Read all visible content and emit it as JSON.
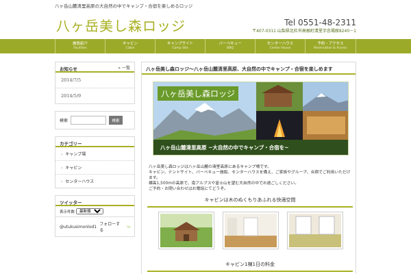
{
  "header": {
    "tagline": "八ヶ岳山麓清里高原の大自然の中でキャンプ・合宿を楽しめるロッジ",
    "logo": "八ヶ岳美し森ロッジ",
    "tel": "Tel 0551-48-2311",
    "address": "〒407-0311 山梨県北杜市高根町清里字念場原8240－1"
  },
  "nav": [
    {
      "jp": "施設紹介",
      "en": "Facilities"
    },
    {
      "jp": "キャビン",
      "en": "Cabin"
    },
    {
      "jp": "キャンプサイト",
      "en": "Camp Site"
    },
    {
      "jp": "バーベキュー",
      "en": "BBQ"
    },
    {
      "jp": "センターハウス",
      "en": "Center House"
    },
    {
      "jp": "予約・アクセス",
      "en": "Reservation & Access"
    }
  ],
  "sidebar": {
    "news": {
      "title": "お知らせ",
      "more": "一覧",
      "dates": [
        "2014/7/5",
        "2014/5/9"
      ]
    },
    "search": {
      "label": "検索",
      "button": "検索",
      "value": ""
    },
    "categories": {
      "title": "カテゴリー",
      "items": [
        "キャンプ場",
        "キャビン",
        "センターハウス"
      ]
    },
    "twitter": {
      "title": "ツイッター",
      "select_label": "表示件数",
      "select_value": "最新順",
      "handle": "@utukusimonlod1",
      "follow": "フォローする"
    }
  },
  "main": {
    "title": "八ヶ岳美し森ロッジ～八ヶ岳山麓清里高原、大自然の中でキャンプ・合宿を楽しめます",
    "banner_title": "八ヶ岳美し森ロッジ",
    "banner_tagline": "八ヶ岳山麓清里高原 ~大自然の中でキャンプ・合宿を~",
    "intro": [
      "八ヶ岳美し森ロッジは八ヶ岳山麓の清里高原にあるキャンプ場です。",
      "キャビン、テントサイト、バーベキュー施設、センターハウスを備え、ご家族やグループ、合宿でご利用いただけます。",
      "標高1,500mの高原で、南アルプスや富士山を望む大自然の中でお過ごしください。",
      "ご予約・お問い合わせはお電話にてどうぞ。"
    ],
    "section1": "キャビンは木のぬくもりあふれる快適空間",
    "section2": "キャビン1棟1日の料金"
  }
}
